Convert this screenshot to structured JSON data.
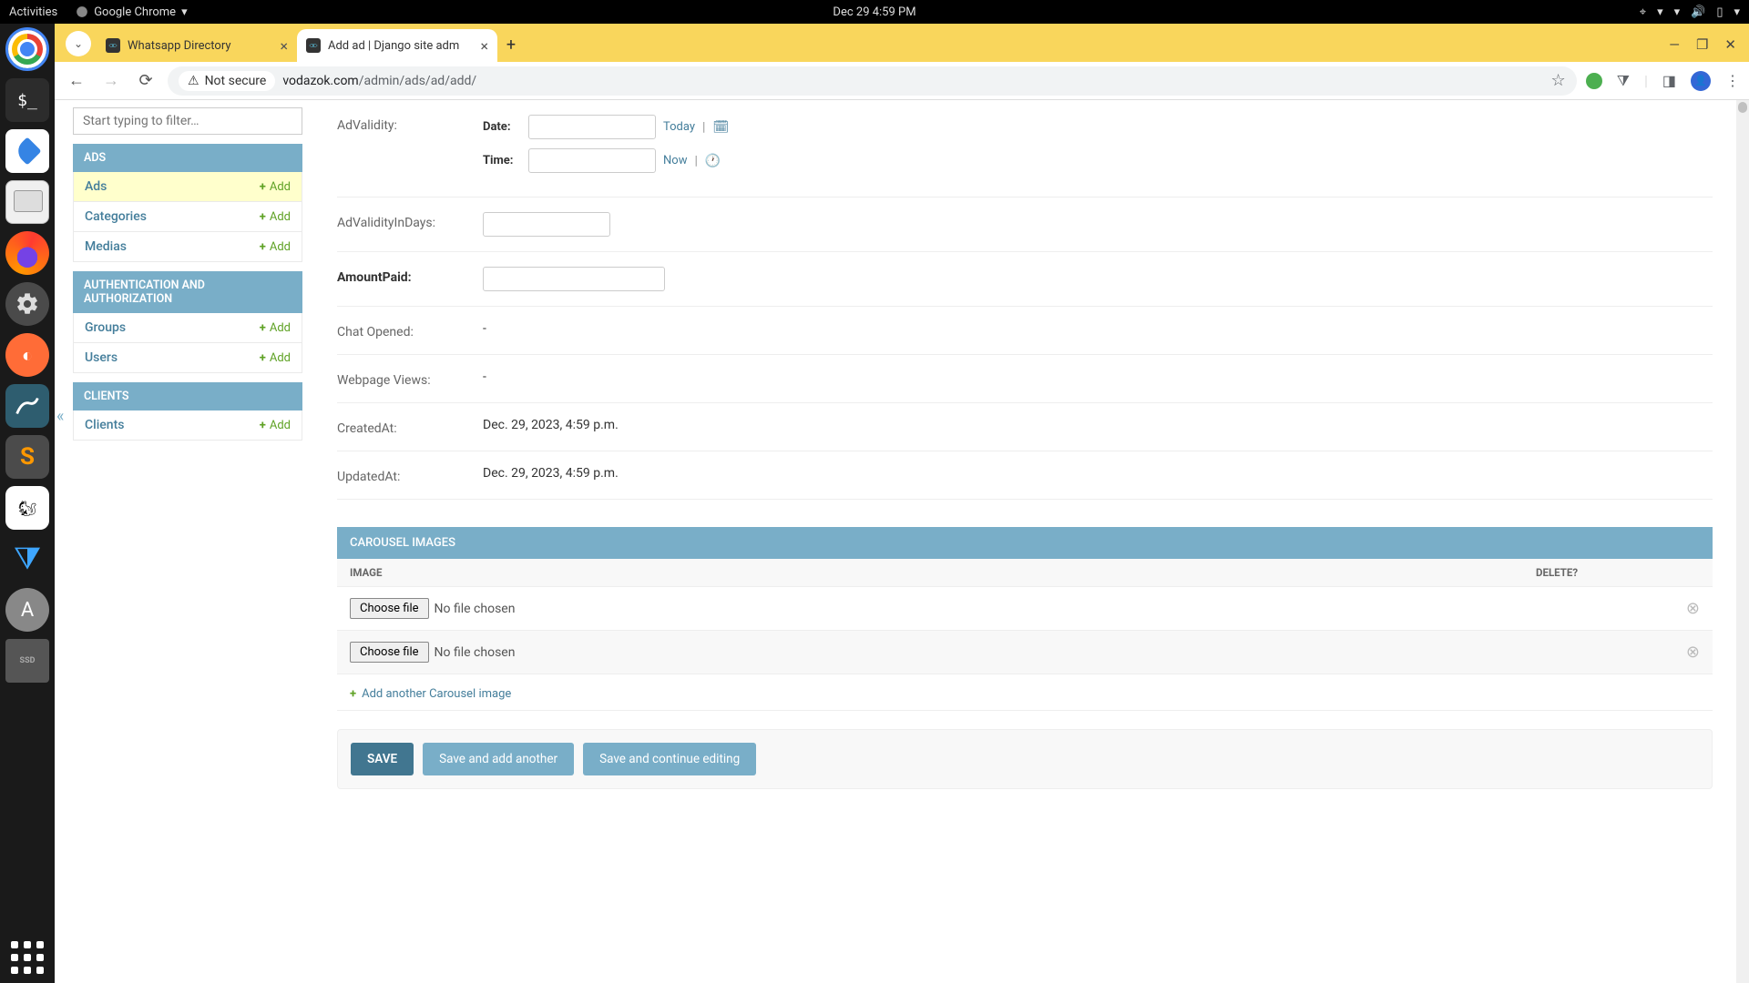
{
  "os": {
    "activities": "Activities",
    "app_name": "Google Chrome",
    "datetime": "Dec 29   4:59 PM"
  },
  "browser": {
    "tabs": [
      {
        "title": "Whatsapp Directory",
        "active": false
      },
      {
        "title": "Add ad | Django site adm",
        "active": true
      }
    ],
    "security_label": "Not secure",
    "url_domain": "vodazok.com",
    "url_path": "/admin/ads/ad/add/"
  },
  "sidebar": {
    "filter_placeholder": "Start typing to filter…",
    "sections": {
      "ads": {
        "header": "ADS",
        "items": [
          {
            "name": "Ads",
            "add": "Add",
            "active": true
          },
          {
            "name": "Categories",
            "add": "Add",
            "active": false
          },
          {
            "name": "Medias",
            "add": "Add",
            "active": false
          }
        ]
      },
      "auth": {
        "header": "AUTHENTICATION AND AUTHORIZATION",
        "items": [
          {
            "name": "Groups",
            "add": "Add"
          },
          {
            "name": "Users",
            "add": "Add"
          }
        ]
      },
      "clients": {
        "header": "CLIENTS",
        "items": [
          {
            "name": "Clients",
            "add": "Add"
          }
        ]
      }
    }
  },
  "form": {
    "advalidity_label": "AdValidity:",
    "date_label": "Date:",
    "today_link": "Today",
    "time_label": "Time:",
    "now_link": "Now",
    "advalidityindays_label": "AdValidityInDays:",
    "amountpaid_label": "AmountPaid:",
    "chatopened_label": "Chat Opened:",
    "chatopened_value": "-",
    "webpageviews_label": "Webpage Views:",
    "webpageviews_value": "-",
    "createdat_label": "CreatedAt:",
    "createdat_value": "Dec. 29, 2023, 4:59 p.m.",
    "updatedat_label": "UpdatedAt:",
    "updatedat_value": "Dec. 29, 2023, 4:59 p.m."
  },
  "carousel": {
    "header": "CAROUSEL IMAGES",
    "col_image": "IMAGE",
    "col_delete": "DELETE?",
    "choose_file": "Choose file",
    "no_file": "No file chosen",
    "add_another": "Add another Carousel image"
  },
  "savebar": {
    "save": "SAVE",
    "save_add": "Save and add another",
    "save_continue": "Save and continue editing"
  }
}
